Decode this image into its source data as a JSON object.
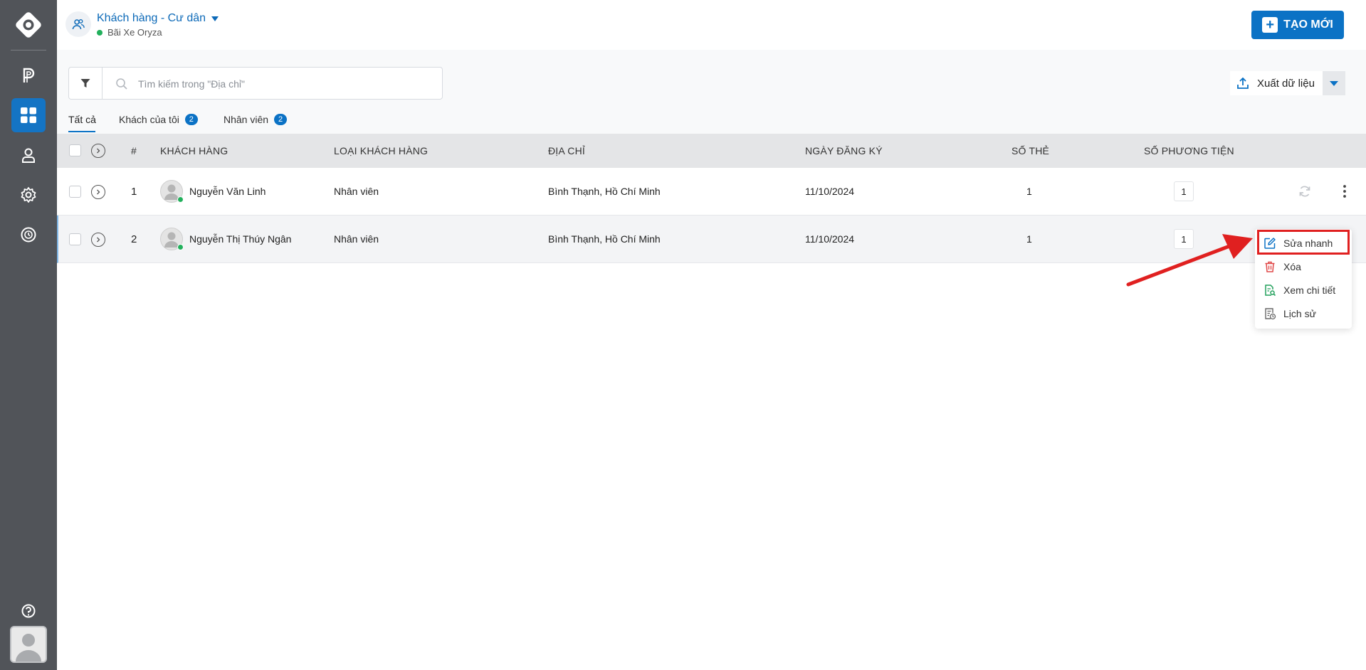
{
  "header": {
    "title": "Khách hàng - Cư dân",
    "subtitle": "Bãi Xe Oryza",
    "new_button": "TẠO MỚI"
  },
  "toolbar": {
    "search_placeholder": "Tìm kiếm trong \"Địa chỉ\"",
    "export_label": "Xuất dữ liệu"
  },
  "tabs": [
    {
      "label": "Tất cả",
      "badge": ""
    },
    {
      "label": "Khách của tôi",
      "badge": "2"
    },
    {
      "label": "Nhân viên",
      "badge": "2"
    }
  ],
  "table": {
    "columns": [
      "#",
      "KHÁCH HÀNG",
      "LOẠI KHÁCH HÀNG",
      "ĐỊA CHỈ",
      "NGÀY ĐĂNG KÝ",
      "SỐ THẺ",
      "SỐ PHƯƠNG TIỆN"
    ],
    "rows": [
      {
        "index": "1",
        "name": "Nguyễn Văn Linh",
        "type": "Nhân viên",
        "address": "Bình Thạnh, Hồ Chí Minh",
        "date": "11/10/2024",
        "cards": "1",
        "vehicles": "1"
      },
      {
        "index": "2",
        "name": "Nguyễn Thị Thúy Ngân",
        "type": "Nhân viên",
        "address": "Bình Thạnh, Hồ Chí Minh",
        "date": "11/10/2024",
        "cards": "1",
        "vehicles": "1"
      }
    ]
  },
  "context_menu": {
    "items": [
      "Sửa nhanh",
      "Xóa",
      "Xem chi tiết",
      "Lịch sử"
    ]
  },
  "colors": {
    "sidebar": "#515459",
    "accent": "#0b72c5",
    "highlight": "#e02020",
    "online": "#22b05c"
  }
}
